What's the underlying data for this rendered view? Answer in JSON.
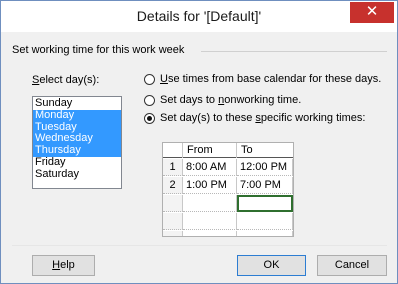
{
  "dialog": {
    "title": "Details for '[Default]'",
    "close_glyph": "✕",
    "group_header": "Set working time for this work week"
  },
  "days": {
    "label_pre": "",
    "label_accel": "S",
    "label_post": "elect day(s):",
    "items": [
      {
        "label": "Sunday",
        "selected": false
      },
      {
        "label": "Monday",
        "selected": true
      },
      {
        "label": "Tuesday",
        "selected": true
      },
      {
        "label": "Wednesday",
        "selected": true
      },
      {
        "label": "Thursday",
        "selected": true
      },
      {
        "label": "Friday",
        "selected": false
      },
      {
        "label": "Saturday",
        "selected": false
      }
    ]
  },
  "options": {
    "base_calendar": {
      "label_pre": "",
      "label_accel": "U",
      "label_post": "se times from base calendar for these days.",
      "checked": false
    },
    "nonworking": {
      "label_pre": "Set days to ",
      "label_accel": "n",
      "label_post": "onworking time.",
      "checked": false
    },
    "specific": {
      "label_pre": "Set day(s) to these ",
      "label_accel": "s",
      "label_post": "pecific working times:",
      "checked": true
    }
  },
  "times": {
    "headers": {
      "from": "From",
      "to": "To"
    },
    "rows": [
      {
        "num": "1",
        "from": "8:00 AM",
        "to": "12:00 PM"
      },
      {
        "num": "2",
        "from": "1:00 PM",
        "to": "7:00 PM"
      },
      {
        "num": "",
        "from": "",
        "to": ""
      },
      {
        "num": "",
        "from": "",
        "to": ""
      },
      {
        "num": "",
        "from": "",
        "to": ""
      }
    ]
  },
  "buttons": {
    "help_accel": "H",
    "help_post": "elp",
    "ok": "OK",
    "cancel": "Cancel"
  },
  "colors": {
    "selection": "#3399ff",
    "close": "#c7312d",
    "active_cell": "#2f6f2f"
  }
}
